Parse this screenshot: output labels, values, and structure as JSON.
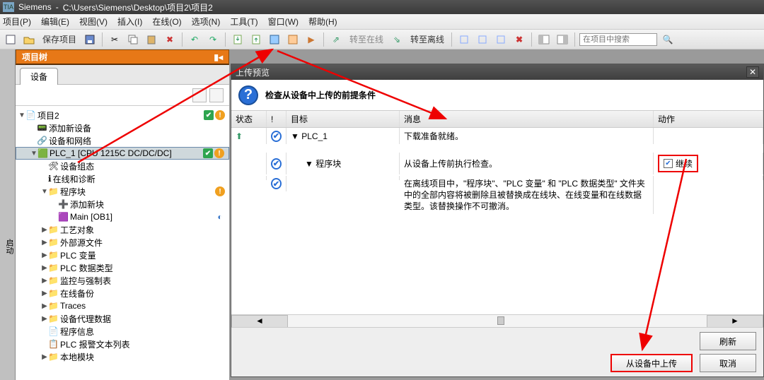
{
  "title": {
    "app": "Siemens",
    "path": "C:\\Users\\Siemens\\Desktop\\项目2\\项目2"
  },
  "menu": {
    "project": "项目(P)",
    "edit": "编辑(E)",
    "view": "视图(V)",
    "insert": "插入(I)",
    "online": "在线(O)",
    "options": "选项(N)",
    "tools": "工具(T)",
    "window": "窗口(W)",
    "help": "帮助(H)"
  },
  "toolbar": {
    "save": "保存项目",
    "go_online": "转至在线",
    "go_offline": "转至离线",
    "search_placeholder": "在项目中搜索"
  },
  "side_rail": "启动",
  "project_tree": {
    "title": "项目树",
    "tab": "设备",
    "root": "项目2",
    "items": {
      "add_device": "添加新设备",
      "devices_networks": "设备和网络",
      "plc1": "PLC_1 [CPU 1215C DC/DC/DC]",
      "device_config": "设备组态",
      "online_diag": "在线和诊断",
      "program_blocks": "程序块",
      "add_block": "添加新块",
      "main_ob1": "Main [OB1]",
      "tech_objects": "工艺对象",
      "ext_sources": "外部源文件",
      "plc_tags": "PLC 变量",
      "plc_datatypes": "PLC 数据类型",
      "watch_tables": "监控与强制表",
      "online_backups": "在线备份",
      "traces": "Traces",
      "proxy_data": "设备代理数据",
      "program_info": "程序信息",
      "alarm_text": "PLC 报警文本列表",
      "local_modules": "本地模块"
    }
  },
  "dialog": {
    "title": "上传预览",
    "header": "检查从设备中上传的前提条件",
    "columns": {
      "status": "状态",
      "flag": "!",
      "target": "目标",
      "message": "消息",
      "action": "动作"
    },
    "rows": [
      {
        "target": "PLC_1",
        "message": "下载准备就绪。",
        "icon": "upload"
      },
      {
        "target": "程序块",
        "message": "从设备上传前执行检查。",
        "action_label": "继续",
        "checked": true
      },
      {
        "message": "在离线项目中，\"程序块\"、\"PLC 变量\" 和 \"PLC 数据类型\" 文件夹中的全部内容将被删除且被替换成在线块、在线变量和在线数据类型。该替换操作不可撤消。"
      }
    ],
    "buttons": {
      "refresh": "刷新",
      "upload": "从设备中上传",
      "cancel": "取消"
    }
  }
}
